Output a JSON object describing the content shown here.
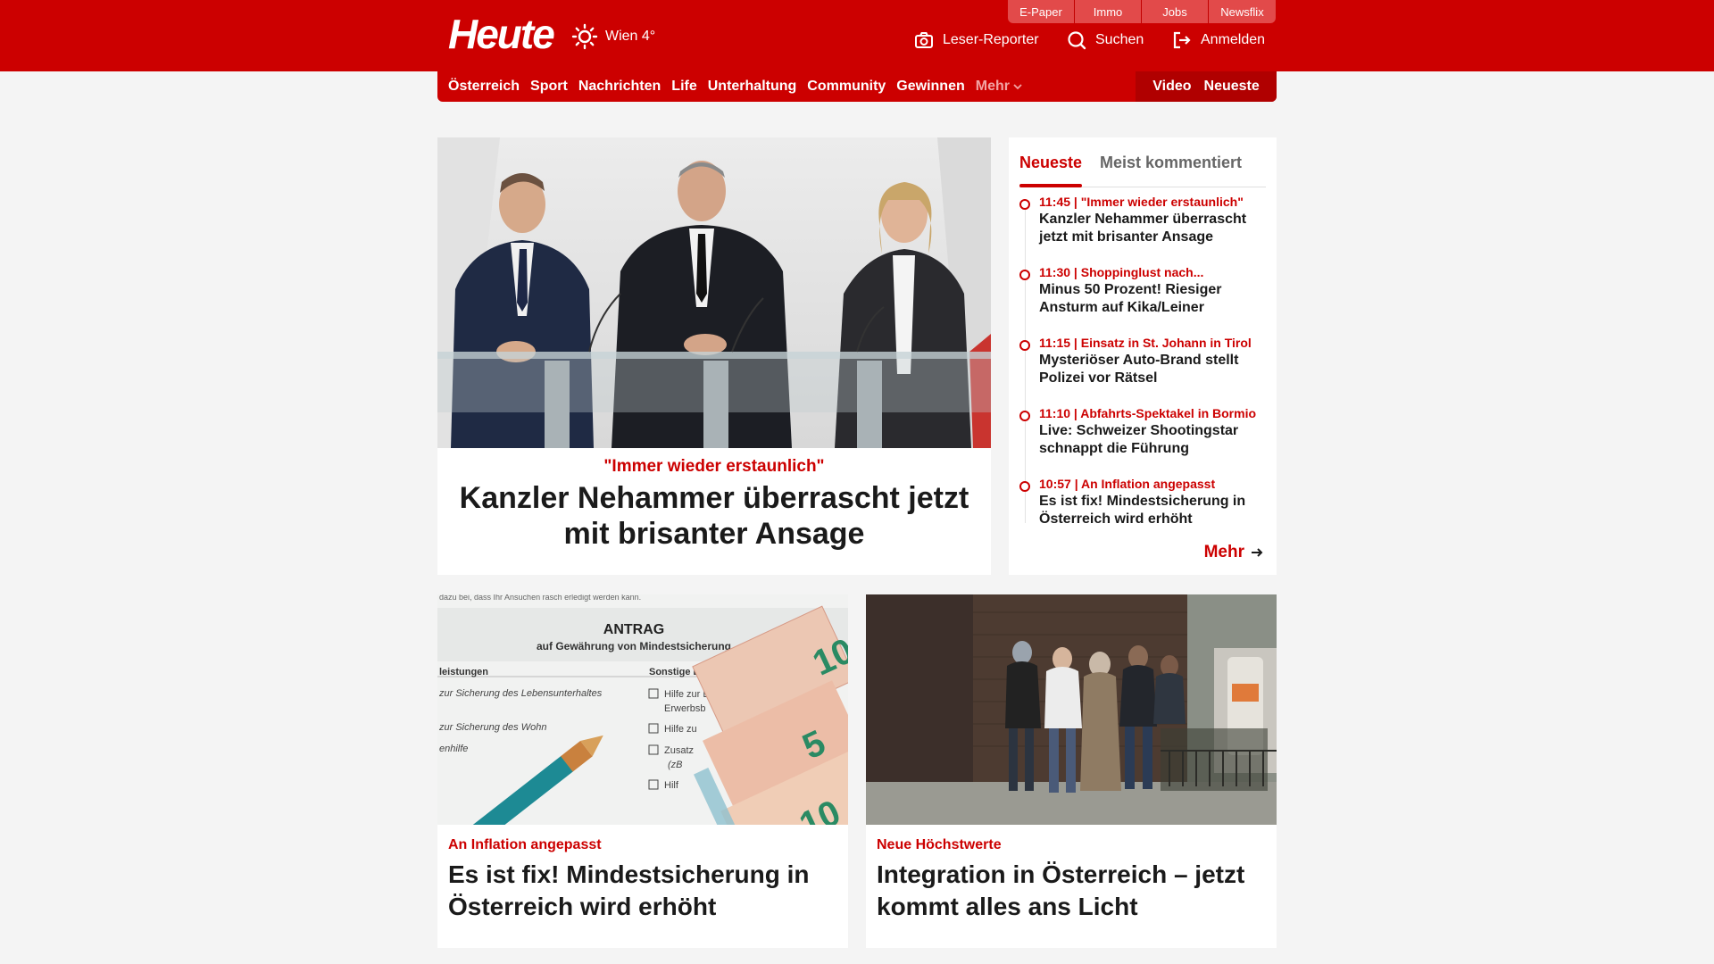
{
  "header": {
    "logo_text": "Heute",
    "weather": {
      "icon": "sun-icon",
      "label": "Wien 4°"
    },
    "service_tabs": [
      "E-Paper",
      "Immo",
      "Jobs",
      "Newsflix"
    ],
    "tools": {
      "reporter": {
        "icon": "camera-icon",
        "label": "Leser-Reporter"
      },
      "search": {
        "icon": "search-icon",
        "label": "Suchen"
      },
      "login": {
        "icon": "login-icon",
        "label": "Anmelden"
      }
    },
    "colors": {
      "brand": "#cc0000"
    }
  },
  "nav": {
    "items": [
      "Österreich",
      "Sport",
      "Nachrichten",
      "Life",
      "Unterhaltung",
      "Community",
      "Gewinnen"
    ],
    "more_label": "Mehr",
    "right": [
      "Video",
      "Neueste"
    ]
  },
  "hero": {
    "kicker": "\"Immer wieder erstaunlich\"",
    "title": "Kanzler Nehammer überrascht jetzt mit brisanter Ansage"
  },
  "sidebar": {
    "tabs": [
      "Neueste",
      "Meist kommentiert"
    ],
    "items": [
      {
        "meta": "11:45 | \"Immer wieder erstaunlich\"",
        "title": "Kanzler Nehammer überrascht jetzt mit brisanter Ansage"
      },
      {
        "meta": "11:30 | Shoppinglust nach...",
        "title": "Minus 50 Prozent! Riesiger Ansturm auf Kika/Leiner"
      },
      {
        "meta": "11:15 | Einsatz in St. Johann in Tirol",
        "title": "Mysteriöser Auto-Brand stellt Polizei vor Rätsel"
      },
      {
        "meta": "11:10 | Abfahrts-Spektakel in Bormio",
        "title": "Live: Schweizer Shootingstar schnappt die Führung"
      },
      {
        "meta": "10:57 | An Inflation angepasst",
        "title": "Es ist fix! Mindestsicherung in Österreich wird erhöht"
      }
    ],
    "more_label": "Mehr"
  },
  "cards": [
    {
      "kicker": "An Inflation angepasst",
      "title": "Es ist fix! Mindestsicherung in Österreich wird erhöht",
      "image_text": {
        "top": "dazu bei, dass Ihr Ansuchen rasch erledigt werden kann.",
        "heading": "ANTRAG",
        "subheading": "auf Gewährung von Mindestsicherung",
        "col_left": "leistungen",
        "col_right": "Sonstige Leist",
        "line1": "zur Sicherung des Lebensunterhaltes",
        "line2": "zur Sicherung des Wohn",
        "line3": "enhilfe",
        "check1": "Hilfe zur E",
        "check1b": "Erwerbsb",
        "check2": "Hilfe zu",
        "check3": "Zusatz",
        "check3b": "(zB",
        "check4": "Hilf",
        "note1": "10",
        "note2": "5",
        "note3": "10"
      }
    },
    {
      "kicker": "Neue Höchstwerte",
      "title": "Integration in Österreich – jetzt kommt alles ans Licht"
    }
  ]
}
